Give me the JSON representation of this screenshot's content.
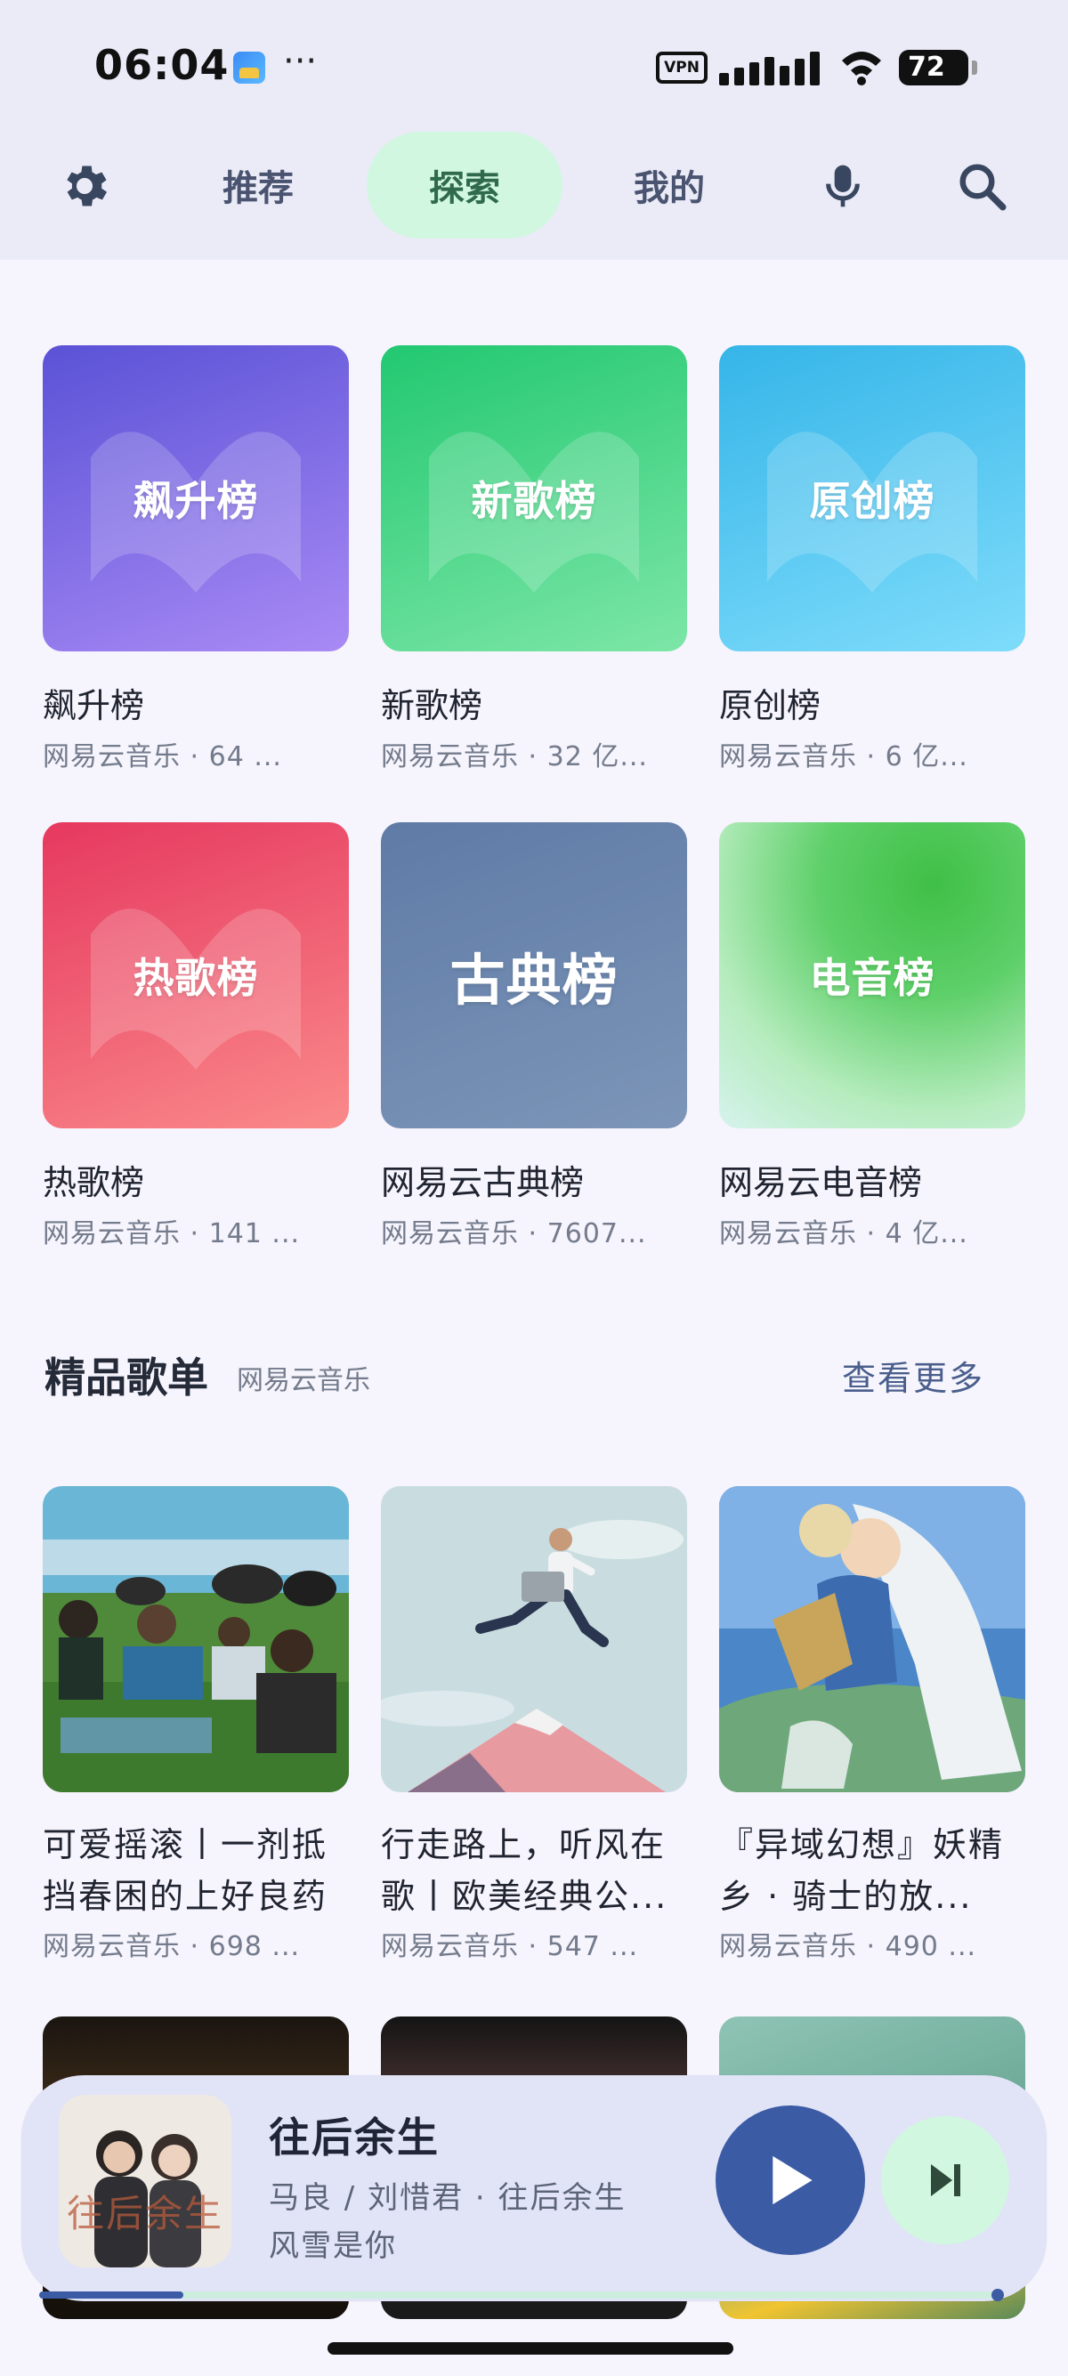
{
  "status_bar": {
    "time": "06:04",
    "more": "···",
    "vpn": "VPN",
    "battery": "72"
  },
  "nav": {
    "settings_icon": "gear-icon",
    "tabs": [
      {
        "label": "推荐",
        "active": false
      },
      {
        "label": "探索",
        "active": true
      },
      {
        "label": "我的",
        "active": false
      }
    ],
    "mic_icon": "microphone-icon",
    "search_icon": "search-icon",
    "accent": "#d1f7e1"
  },
  "charts": [
    {
      "cover_text": "飙升榜",
      "title": "飙升榜",
      "source": "网易云音乐",
      "count": "64 ...",
      "colors": [
        "#5a52d6",
        "#a98af5"
      ]
    },
    {
      "cover_text": "新歌榜",
      "title": "新歌榜",
      "source": "网易云音乐",
      "count": "32 亿...",
      "colors": [
        "#22c871",
        "#7de6a7"
      ]
    },
    {
      "cover_text": "原创榜",
      "title": "原创榜",
      "source": "网易云音乐",
      "count": "6 亿...",
      "colors": [
        "#35b5e8",
        "#7fdcfb"
      ]
    },
    {
      "cover_text": "热歌榜",
      "title": "热歌榜",
      "source": "网易云音乐",
      "count": "141 ...",
      "colors": [
        "#e6385f",
        "#fa8a8a"
      ]
    },
    {
      "cover_text": "古典榜",
      "title": "网易云古典榜",
      "source": "网易云音乐",
      "count": "7607...",
      "colors": [
        "#5f7ba6",
        "#7c95b8"
      ]
    },
    {
      "cover_text": "电音榜",
      "title": "网易云电音榜",
      "source": "网易云音乐",
      "count": "4 亿...",
      "colors": [
        "#3fbf46",
        "#d6f3ee"
      ]
    }
  ],
  "section": {
    "title": "精品歌单",
    "source": "网易云音乐",
    "more": "查看更多"
  },
  "playlists": [
    {
      "title": "可爱摇滚丨一剂抵挡春困的上好良药",
      "source": "网易云音乐",
      "count": "698 ..."
    },
    {
      "title": "行走路上，听风在歌丨欧美经典公...",
      "source": "网易云音乐",
      "count": "547 ..."
    },
    {
      "title": "『异域幻想』妖精乡 · 骑士的放...",
      "source": "网易云音乐",
      "count": "490 ..."
    }
  ],
  "player": {
    "title": "往后余生",
    "artists_album": "马良 / 刘惜君  ·  往后余生",
    "lyric": "风雪是你",
    "cover_text": "往后余生",
    "progress": 0.15,
    "play_icon": "play-icon",
    "next_icon": "skip-next-icon"
  }
}
